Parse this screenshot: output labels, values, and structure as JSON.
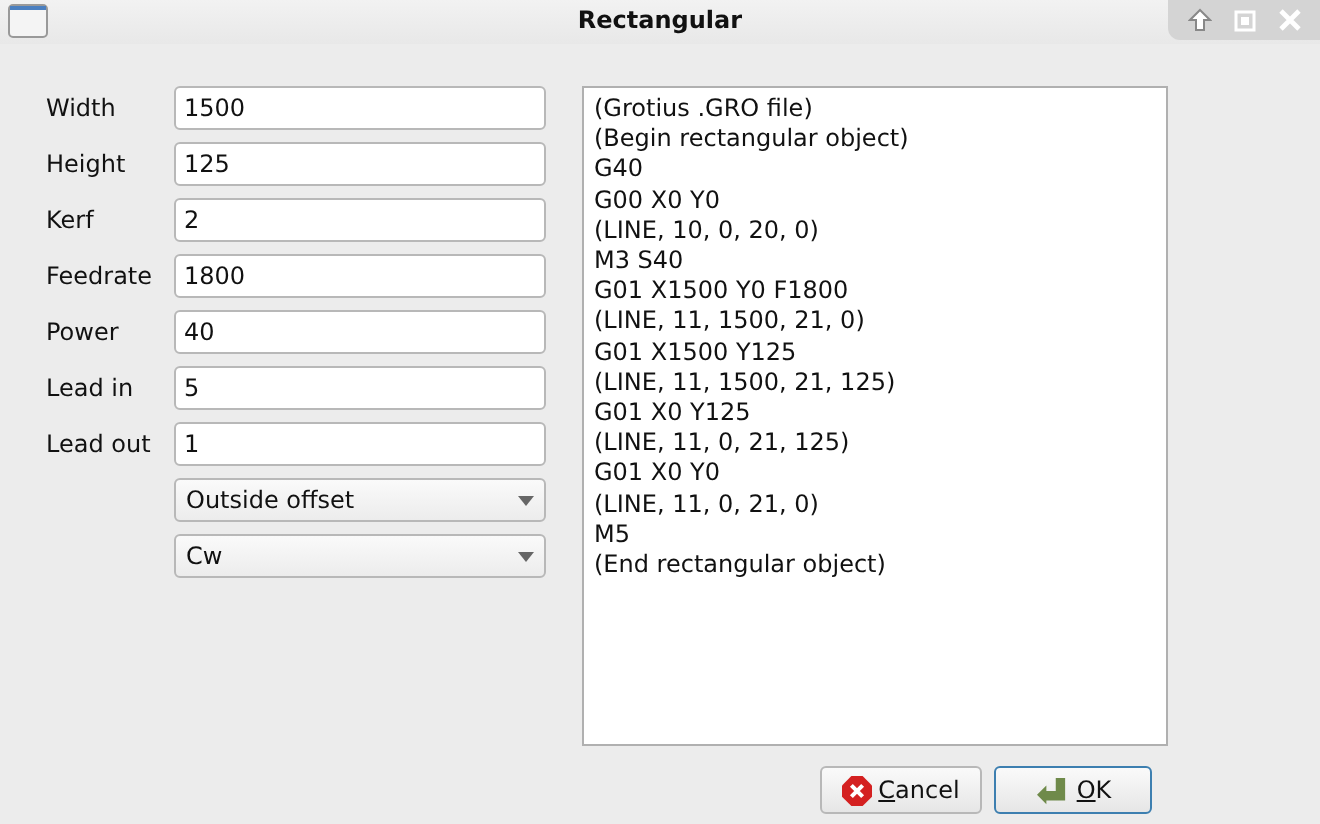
{
  "window": {
    "title": "Rectangular"
  },
  "fields": [
    {
      "label": "Width",
      "value": "1500"
    },
    {
      "label": "Height",
      "value": "125"
    },
    {
      "label": "Kerf",
      "value": "2"
    },
    {
      "label": "Feedrate",
      "value": "1800"
    },
    {
      "label": "Power",
      "value": "40"
    },
    {
      "label": "Lead in",
      "value": "5"
    },
    {
      "label": "Lead out",
      "value": "1"
    }
  ],
  "dropdowns": [
    {
      "value": "Outside offset"
    },
    {
      "value": "Cw"
    }
  ],
  "output_lines": [
    "(Grotius .GRO file)",
    "(Begin rectangular object)",
    "G40",
    "G00 X0 Y0",
    "(LINE, 10, 0, 20, 0)",
    "M3 S40",
    "G01 X1500 Y0 F1800",
    "(LINE, 11, 1500, 21, 0)",
    "G01 X1500 Y125",
    "(LINE, 11, 1500, 21, 125)",
    "G01 X0 Y125",
    "(LINE, 11, 0, 21, 125)",
    "G01 X0 Y0",
    "(LINE, 11, 0, 21, 0)",
    "M5",
    "(End rectangular object)"
  ],
  "buttons": [
    {
      "kind": "cancel",
      "label": "Cancel",
      "default": false
    },
    {
      "kind": "ok",
      "label": "OK",
      "default": true
    }
  ]
}
